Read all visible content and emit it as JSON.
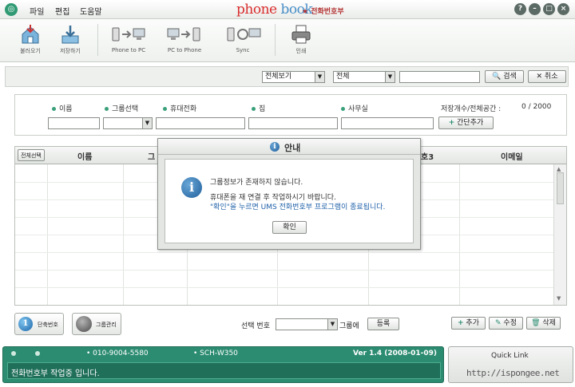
{
  "menu": {
    "file": "파일",
    "edit": "편집",
    "help": "도움말"
  },
  "brand": {
    "logo_p1": "phone",
    "logo_p2": "book",
    "subtitle": "★ 전화번호부"
  },
  "toolbar": [
    {
      "label": "불러오기",
      "icon": "house-import-icon"
    },
    {
      "label": "저장하기",
      "icon": "save-tray-icon"
    },
    {
      "label": "Phone to PC",
      "icon": "phone-to-pc-icon"
    },
    {
      "label": "PC to Phone",
      "icon": "pc-to-phone-icon"
    },
    {
      "label": "Sync",
      "icon": "sync-icon"
    },
    {
      "label": "인쇄",
      "icon": "printer-icon"
    }
  ],
  "search": {
    "view_select": "전체보기",
    "scope_select": "전체",
    "query": "",
    "search_button": "검색",
    "cancel_button": "취소"
  },
  "entry": {
    "name_label": "이름",
    "group_label": "그룹선택",
    "mobile_label": "휴대전화",
    "home_label": "집",
    "office_label": "사무실",
    "capacity_label": "저장개수/전체공간 :",
    "capacity_value": "0 / 2000",
    "quick_add_button": "간단추가"
  },
  "grid": {
    "select_all_button": "전체선택",
    "columns": [
      "이름",
      "그",
      "호3",
      "이메일"
    ]
  },
  "dialog": {
    "title": "안내",
    "line1": "그룹정보가 존재하지 않습니다.",
    "line2": "휴대폰을 재 연결 후 작업하시기 바랍니다.",
    "line3": "\"확인\"을 누르면 UMS 전화번호부 프로그램이 종료됩니다.",
    "ok_button": "확인"
  },
  "bottom": {
    "speed_dial_button": "단축번호",
    "group_manage_button": "그룹관리",
    "selected_number_label": "선택 번호",
    "to_group_label": "그룹에",
    "register_button": "등록",
    "add_button": "추가",
    "edit_button": "수정",
    "delete_button": "삭제"
  },
  "status": {
    "phone_number": "010-9004-5580",
    "model": "SCH-W350",
    "version": "Ver 1.4 (2008-01-09)",
    "message": "전화번호부 작업중 입니다."
  },
  "quick_link": {
    "title": "Quick Link",
    "watermark": "http://ispongee.net"
  },
  "colors": {
    "accent": "#2c8c71",
    "dot": "#3aa07a",
    "highlight_text": "#1d5fa8"
  }
}
